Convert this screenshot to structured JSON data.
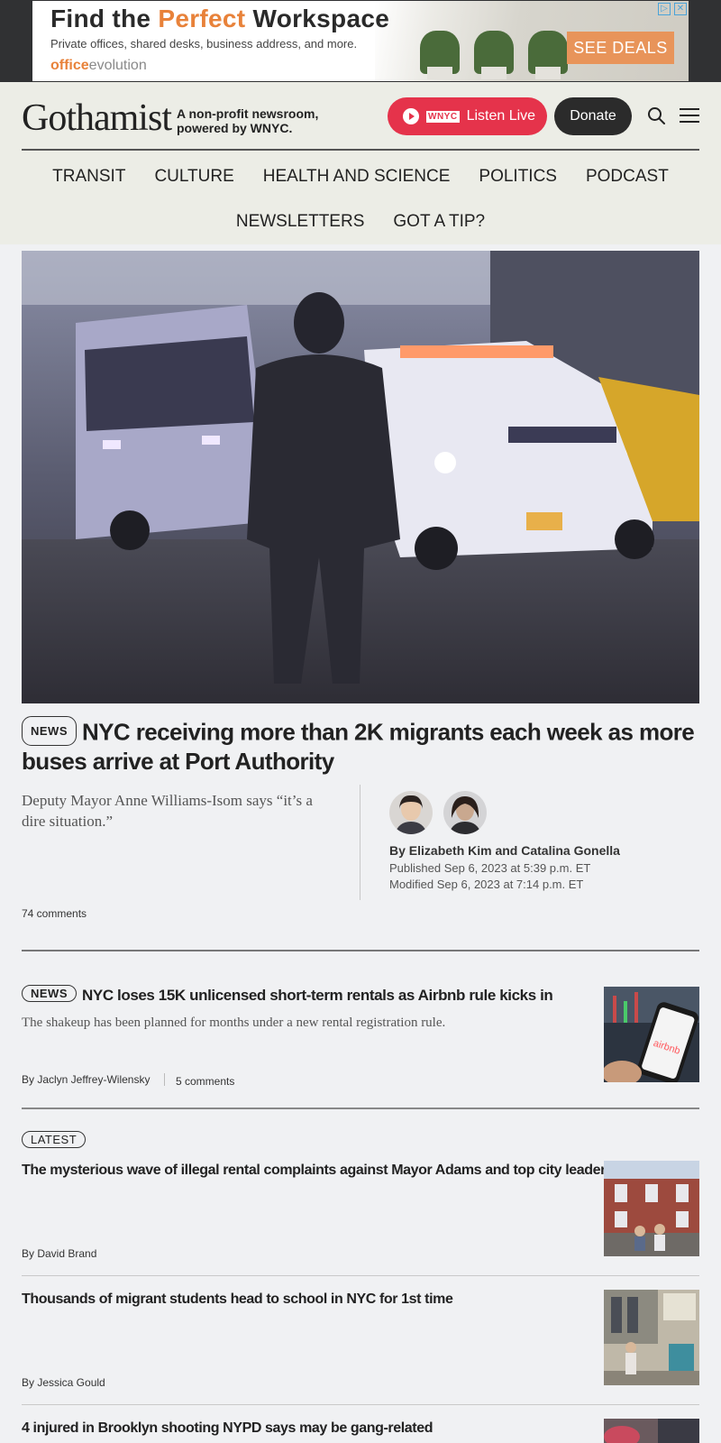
{
  "ad": {
    "title_before": "Find the ",
    "title_accent": "Perfect",
    "title_after": " Workspace",
    "subtitle": "Private offices, shared desks, business address, and more.",
    "brand_prefix": "office",
    "brand_suffix": "evolution",
    "cta": "SEE DEALS",
    "colors": {
      "accent": "#e8823a",
      "cta": "#e8945a"
    }
  },
  "header": {
    "logo": "Gothamist",
    "tagline_line1": "A non-profit newsroom,",
    "tagline_line2": "powered by WNYC.",
    "wnyc_label": "WNYC",
    "listen_label": "Listen Live",
    "donate_label": "Donate",
    "colors": {
      "listen": "#e5334b",
      "donate": "#2b2b2b",
      "background": "#ecede6"
    }
  },
  "nav": {
    "row1": [
      "TRANSIT",
      "CULTURE",
      "HEALTH AND SCIENCE",
      "POLITICS",
      "PODCAST"
    ],
    "row2": [
      "NEWSLETTERS",
      "GOT A TIP?"
    ]
  },
  "lead": {
    "tag": "NEWS",
    "headline": "NYC receiving more than 2K migrants each week as more buses arrive at Port Authority",
    "dek": "Deputy Mayor Anne Williams-Isom says “it’s a dire situation.”",
    "byline": "By Elizabeth Kim and Catalina Gonella",
    "published": "Published Sep 6, 2023 at 5:39 p.m. ET",
    "modified": "Modified Sep 6, 2023 at 7:14 p.m. ET",
    "comments": "74 comments"
  },
  "story2": {
    "tag": "NEWS",
    "headline": "NYC loses 15K unlicensed short-term rentals as Airbnb rule kicks in",
    "dek": "The shakeup has been planned for months under a new rental registration rule.",
    "byline": "By Jaclyn Jeffrey-Wilensky",
    "comments": "5 comments",
    "thumb_text": "airbnb"
  },
  "latest": {
    "tag": "LATEST",
    "items": [
      {
        "headline": "The mysterious wave of illegal rental complaints against Mayor Adams and top city leaders",
        "byline": "By David Brand"
      },
      {
        "headline": "Thousands of migrant students head to school in NYC for 1st time",
        "byline": "By Jessica Gould"
      },
      {
        "headline": "4 injured in Brooklyn shooting NYPD says may be gang-related",
        "byline": ""
      }
    ]
  }
}
